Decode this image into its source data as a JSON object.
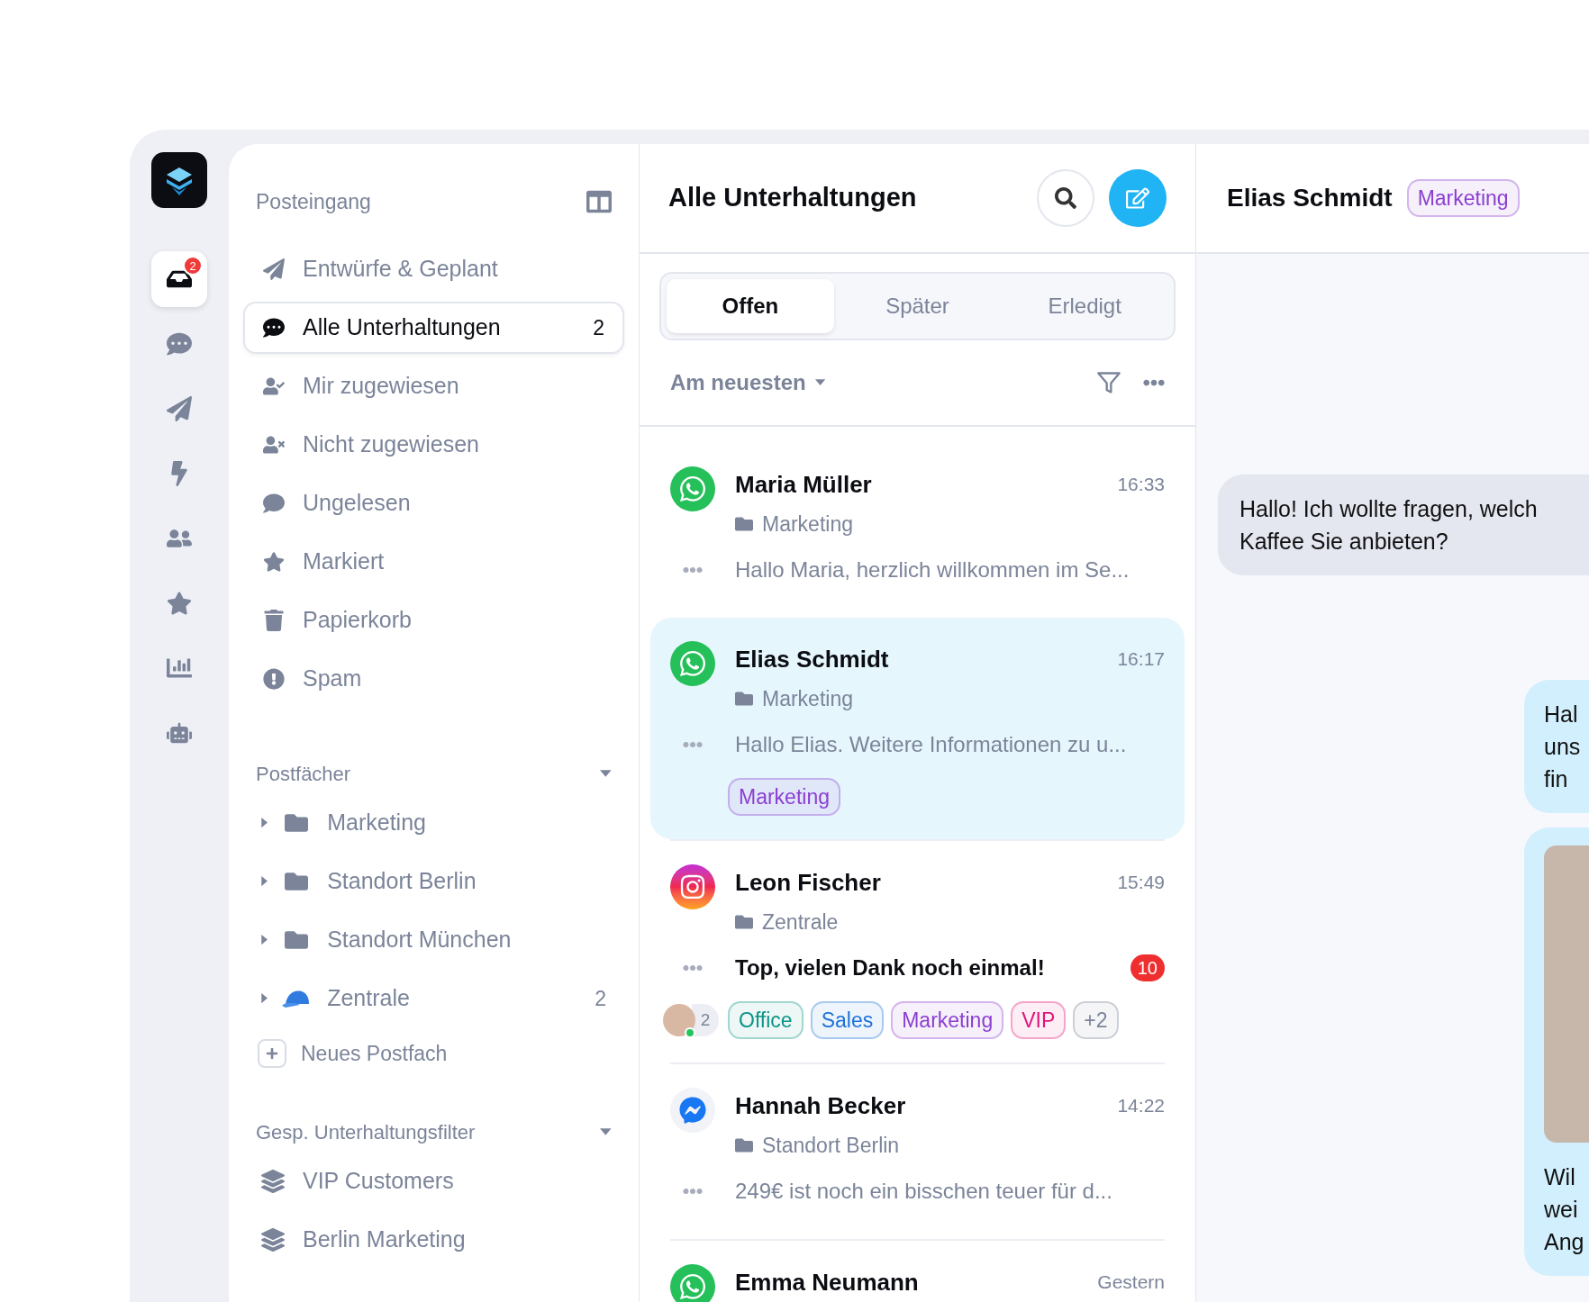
{
  "rail": {
    "items": [
      {
        "kind": "inbox",
        "selected": true,
        "badge": "2"
      },
      {
        "kind": "chat",
        "selected": false
      },
      {
        "kind": "send",
        "selected": false
      },
      {
        "kind": "bolt",
        "selected": false
      },
      {
        "kind": "users",
        "selected": false
      },
      {
        "kind": "star",
        "selected": false
      },
      {
        "kind": "chart",
        "selected": false
      },
      {
        "kind": "bot",
        "selected": false
      }
    ]
  },
  "sidebar": {
    "title": "Posteingang",
    "items": [
      {
        "kind": "send",
        "label": "Entwürfe & Geplant",
        "selected": false
      },
      {
        "kind": "chat",
        "label": "Alle Unterhaltungen",
        "count": "2",
        "selected": true
      },
      {
        "kind": "assigned",
        "label": "Mir zugewiesen",
        "selected": false
      },
      {
        "kind": "unassigned",
        "label": "Nicht zugewiesen",
        "selected": false
      },
      {
        "kind": "unread",
        "label": "Ungelesen",
        "selected": false
      },
      {
        "kind": "starred",
        "label": "Markiert",
        "selected": false
      },
      {
        "kind": "trash",
        "label": "Papierkorb",
        "selected": false
      },
      {
        "kind": "spam",
        "label": "Spam",
        "selected": false
      }
    ],
    "mailboxes": {
      "title": "Postfächer",
      "expanded": true,
      "items": [
        {
          "kind": "folder",
          "label": "Marketing",
          "expanded": false
        },
        {
          "kind": "folder",
          "label": "Standort Berlin",
          "expanded": false
        },
        {
          "kind": "folder",
          "label": "Standort München",
          "expanded": false
        },
        {
          "kind": "emoji",
          "label": "Zentrale",
          "count": "2",
          "expanded": false
        }
      ],
      "new_label": "Neues Postfach"
    },
    "saved_filters": {
      "title": "Gesp. Unterhaltungsfilter",
      "expanded": true,
      "items": [
        {
          "label": "VIP Customers"
        },
        {
          "label": "Berlin Marketing"
        }
      ]
    }
  },
  "conversations": {
    "title": "Alle Unterhaltungen",
    "tabs": [
      {
        "label": "Offen",
        "selected": true
      },
      {
        "label": "Später",
        "selected": false
      },
      {
        "label": "Erledigt",
        "selected": false
      }
    ],
    "sort": "Am neuesten",
    "items": [
      {
        "kind": "whatsapp",
        "name": "Maria Müller",
        "time": "16:33",
        "mailbox": "Marketing",
        "preview": "Hallo Maria, herzlich willkommen im Se...",
        "unread": false,
        "selected": false
      },
      {
        "kind": "whatsapp",
        "name": "Elias Schmidt",
        "time": "16:17",
        "mailbox": "Marketing",
        "preview": "Hallo Elias. Weitere Informationen zu u...",
        "unread": false,
        "selected": true,
        "tags": [
          {
            "label": "Marketing",
            "color": "#8b3fd1"
          }
        ]
      },
      {
        "kind": "instagram",
        "name": "Leon Fischer",
        "time": "15:49",
        "mailbox": "Zentrale",
        "preview": "Top, vielen Dank noch einmal!",
        "unread": true,
        "badge": "10",
        "selected": false,
        "assignee_count": "2",
        "tags": [
          {
            "label": "Office",
            "color": "#0d9488"
          },
          {
            "label": "Sales",
            "color": "#1d72d8"
          },
          {
            "label": "Marketing",
            "color": "#8b3fd1"
          },
          {
            "label": "VIP",
            "color": "#e0157a"
          },
          {
            "label": "+2",
            "color": "#7b8499"
          }
        ]
      },
      {
        "kind": "messenger",
        "name": "Hannah Becker",
        "time": "14:22",
        "mailbox": "Standort Berlin",
        "preview": "249€ ist noch ein bisschen teuer für d...",
        "unread": false,
        "selected": false
      },
      {
        "kind": "whatsapp",
        "name": "Emma Neumann",
        "time": "Gestern",
        "selected": false
      }
    ]
  },
  "chat": {
    "name": "Elias Schmidt",
    "tag": {
      "label": "Marketing",
      "color": "#8b3fd1"
    },
    "messages": [
      {
        "kind": "received",
        "lines": [
          "Hallo! Ich wollte fragen, welch",
          "Kaffee Sie anbieten?"
        ]
      },
      {
        "kind": "sent",
        "lines": [
          "Hal",
          "uns",
          "fin"
        ]
      },
      {
        "kind": "sent-image",
        "lines": [
          "Wil",
          "wei",
          "Ang"
        ]
      }
    ]
  }
}
